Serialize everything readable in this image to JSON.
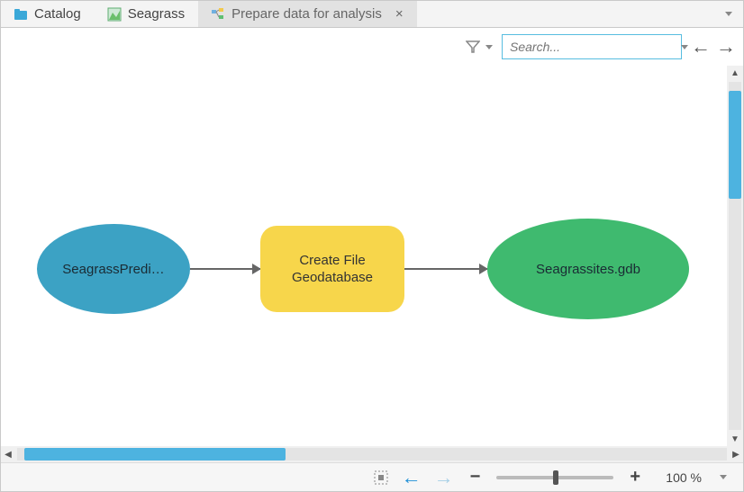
{
  "tabs": [
    {
      "label": "Catalog",
      "icon": "catalog-icon",
      "color": "#2aa4d4"
    },
    {
      "label": "Seagrass",
      "icon": "map-layer-icon",
      "color": "#6bbf6b"
    },
    {
      "label": "Prepare data for analysis",
      "icon": "modelbuilder-icon",
      "active": true,
      "closable": true
    }
  ],
  "toolbar": {
    "search_placeholder": "Search..."
  },
  "model": {
    "input_variable": "SeagrassPredi…",
    "tool_label": "Create File Geodatabase",
    "output_data": "Seagrassites.gdb"
  },
  "statusbar": {
    "zoom_percent": "100 %"
  },
  "colors": {
    "accent": "#4db3e0",
    "tool_fill": "#f7d64b",
    "output_fill": "#3fba6f",
    "input_fill": "#3ca2c4"
  }
}
